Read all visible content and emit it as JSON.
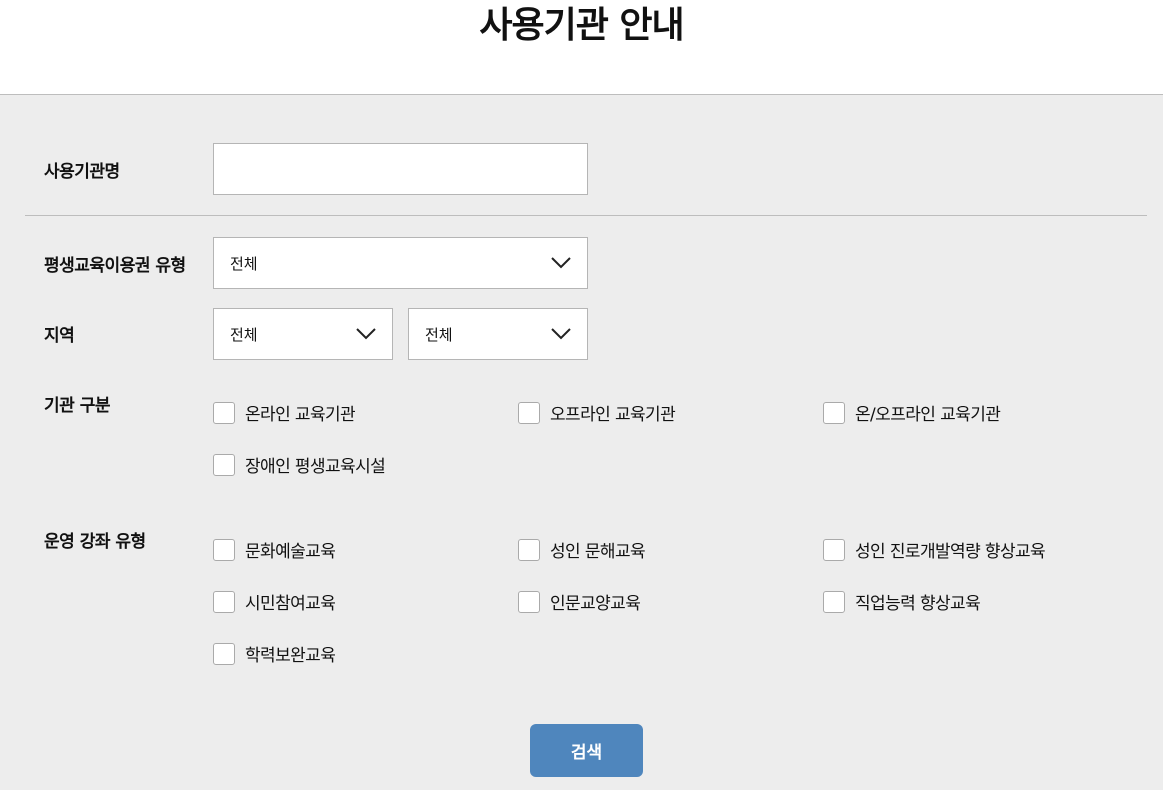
{
  "page": {
    "title": "사용기관 안내"
  },
  "form": {
    "org_name": {
      "label": "사용기관명",
      "value": "",
      "placeholder": ""
    },
    "voucher_type": {
      "label": "평생교육이용권 유형",
      "selected": "전체"
    },
    "region": {
      "label": "지역",
      "first_selected": "전체",
      "second_selected": "전체"
    },
    "org_category": {
      "label": "기관 구분",
      "options": [
        "온라인 교육기관",
        "오프라인 교육기관",
        "온/오프라인 교육기관",
        "장애인 평생교육시설"
      ]
    },
    "course_type": {
      "label": "운영 강좌 유형",
      "options": [
        "문화예술교육",
        "성인 문해교육",
        "성인 진로개발역량 향상교육",
        "시민참여교육",
        "인문교양교육",
        "직업능력 향상교육",
        "학력보완교육"
      ]
    },
    "search_label": "검색"
  },
  "icons": {
    "dropdown": "chevron-down-icon"
  },
  "colors": {
    "button": "#4f86bd",
    "panel": "#ededed"
  }
}
